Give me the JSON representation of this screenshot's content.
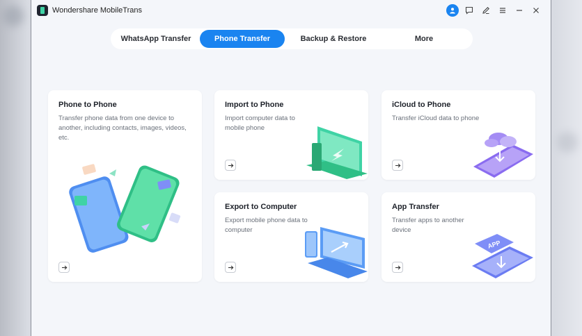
{
  "app": {
    "title": "Wondershare MobileTrans"
  },
  "titlebar": {
    "icons": [
      "user-icon",
      "feedback-icon",
      "edit-icon",
      "menu-icon",
      "minimize-icon",
      "close-icon"
    ]
  },
  "tabs": [
    {
      "label": "WhatsApp Transfer",
      "active": false
    },
    {
      "label": "Phone Transfer",
      "active": true
    },
    {
      "label": "Backup & Restore",
      "active": false
    },
    {
      "label": "More",
      "active": false
    }
  ],
  "cards": {
    "phone_to_phone": {
      "title": "Phone to Phone",
      "desc": "Transfer phone data from one device to another, including contacts, images, videos, etc."
    },
    "import_to_phone": {
      "title": "Import to Phone",
      "desc": "Import computer data to mobile phone"
    },
    "icloud_to_phone": {
      "title": "iCloud to Phone",
      "desc": "Transfer iCloud data to phone"
    },
    "export_to_computer": {
      "title": "Export to Computer",
      "desc": "Export mobile phone data to computer"
    },
    "app_transfer": {
      "title": "App Transfer",
      "desc": "Transfer apps to another device",
      "badge": "APP"
    }
  },
  "colors": {
    "accent": "#1a84f0",
    "green": "#3fd3a5",
    "purple": "#8a6cf0",
    "blue_illus": "#5b9cf5"
  }
}
